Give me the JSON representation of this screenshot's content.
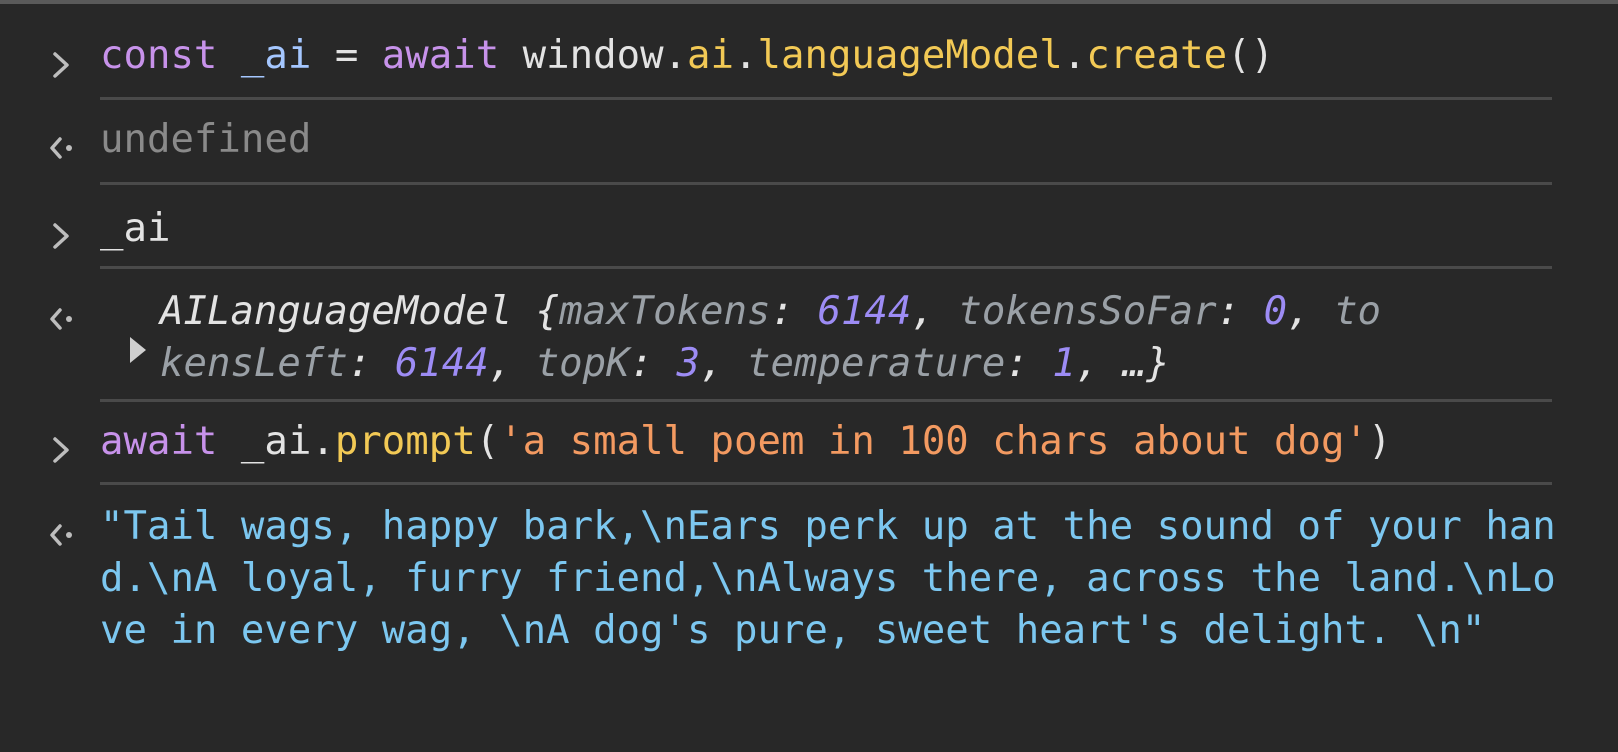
{
  "entries": [
    {
      "kind": "input",
      "tokens": {
        "t1": "const",
        "t2": " ",
        "t3": "_ai",
        "t4": " = ",
        "t5": "await",
        "t6": " window.",
        "t7": "ai",
        "t8": ".",
        "t9": "languageModel",
        "t10": ".",
        "t11": "create",
        "t12": "()"
      }
    },
    {
      "kind": "output",
      "text": "undefined"
    },
    {
      "kind": "input",
      "text": "_ai"
    },
    {
      "kind": "output",
      "object": {
        "class_name": "AILanguageModel",
        "open": " {",
        "k1": "maxTokens",
        "v1": "6144",
        "k2": "tokensSoFar",
        "v2": "0",
        "k3a": "to",
        "k3b": "kensLeft",
        "v3": "6144",
        "k4": "topK",
        "v4": "3",
        "k5": "temperature",
        "v5": "1",
        "close": ", …}",
        "colon": ": ",
        "comma": ", "
      }
    },
    {
      "kind": "input",
      "tokens": {
        "t1": "await",
        "t2": " _ai.",
        "t3": "prompt",
        "t4": "(",
        "t5": "'a small poem in 100 chars about dog'",
        "t6": ")"
      }
    },
    {
      "kind": "output",
      "text": "\"Tail wags, happy bark,\\nEars perk up at the sound of your hand.\\nA loyal, furry friend,\\nAlways there, across the land.\\nLove in every wag, \\nA dog's pure, sweet heart's delight. \\n\""
    }
  ],
  "icons": {
    "prompt": "chevron-right-icon",
    "result": "return-arrow-icon",
    "expand": "triangle-right-icon"
  },
  "colors": {
    "background": "#282828",
    "keyword": "#c792ea",
    "function": "#f2c955",
    "string": "#f39a61",
    "number": "#9d8cf5",
    "result_string": "#7cc7f0",
    "muted": "#8a8a8a"
  }
}
